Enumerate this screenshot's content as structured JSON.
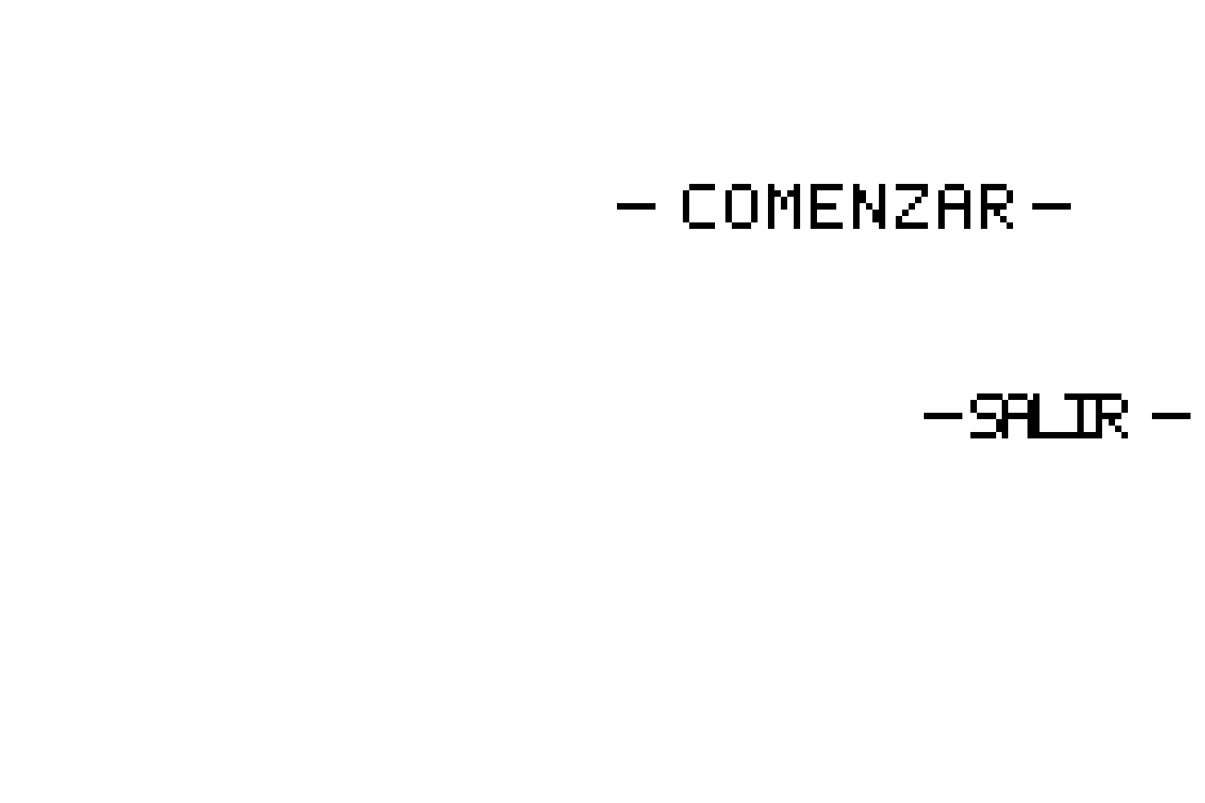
{
  "menu": {
    "start_label": "COMENZAR",
    "exit_label": "SALIR",
    "marker": "—"
  },
  "colors": {
    "background": "#ffffff",
    "text": "#000000"
  }
}
